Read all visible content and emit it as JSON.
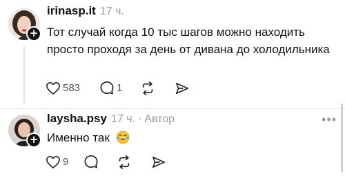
{
  "posts": [
    {
      "username": "irinasp.it",
      "time": "17 ч.",
      "author_label": "",
      "text": "Тот случай когда 10 тыс шагов можно находить просто проходя за день от дивана до холодильника",
      "likes": "583",
      "replies": "1",
      "follow_symbol": "+"
    },
    {
      "username": "laysha.psy",
      "time": "17 ч.",
      "separator": "·",
      "author_label": "Автор",
      "text": "Именно так",
      "likes": "9",
      "replies": "",
      "follow_symbol": "+",
      "more_symbol": "•••"
    }
  ],
  "icons": {
    "like": "heart-icon",
    "reply": "comment-icon",
    "repost": "repost-icon",
    "share": "send-icon",
    "emoji": "laughing-tears-emoji"
  },
  "colors": {
    "text": "#111111",
    "muted": "#999999",
    "divider": "#e6e6e6",
    "thread_line": "#e3e3e3"
  }
}
